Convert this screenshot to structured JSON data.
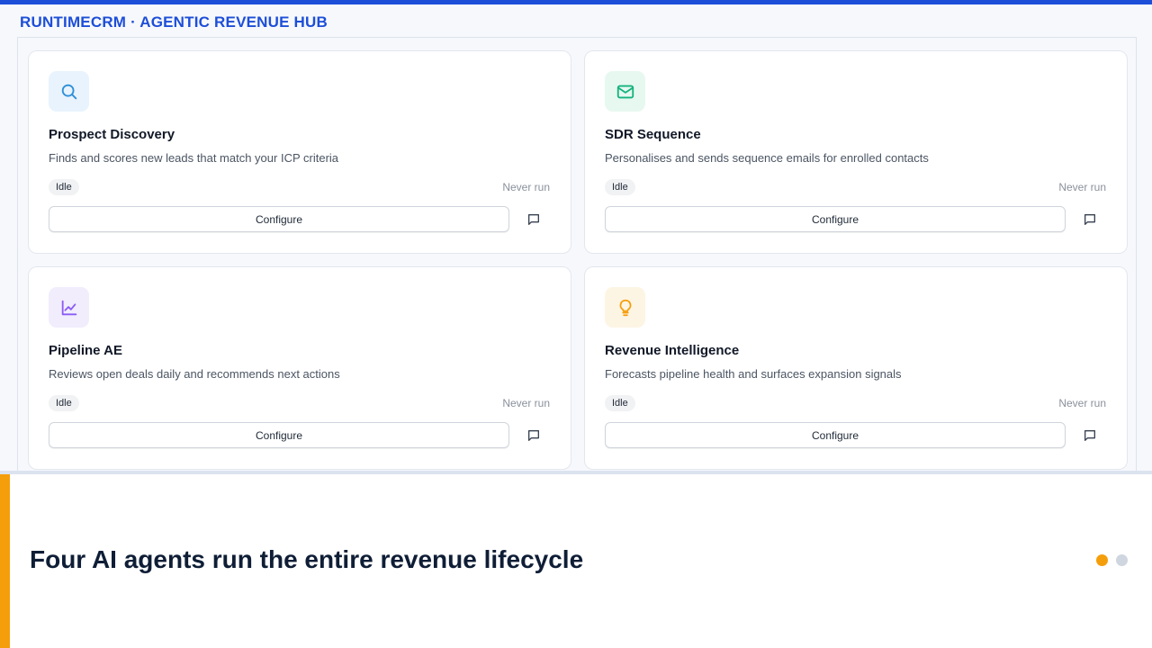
{
  "brand": {
    "title": "RUNTIMECRM · AGENTIC REVENUE HUB"
  },
  "colors": {
    "brand_blue": "#1d4ed8",
    "accent_orange": "#f59e0b",
    "headline_navy": "#0f1e36"
  },
  "agents": [
    {
      "title": "Prospect Discovery",
      "description": "Finds and scores new leads that match your ICP criteria",
      "status": "Idle",
      "last_run": "Never run",
      "configure_label": "Configure",
      "icon": "search-icon",
      "icon_color": "#2f8fd8",
      "icon_bg": "#e8f3fd"
    },
    {
      "title": "SDR Sequence",
      "description": "Personalises and sends sequence emails for enrolled contacts",
      "status": "Idle",
      "last_run": "Never run",
      "configure_label": "Configure",
      "icon": "mail-icon",
      "icon_color": "#14b37d",
      "icon_bg": "#e7f8f1"
    },
    {
      "title": "Pipeline AE",
      "description": "Reviews open deals daily and recommends next actions",
      "status": "Idle",
      "last_run": "Never run",
      "configure_label": "Configure",
      "icon": "line-chart-icon",
      "icon_color": "#8b5cf6",
      "icon_bg": "#f1edfd"
    },
    {
      "title": "Revenue Intelligence",
      "description": "Forecasts pipeline health and surfaces expansion signals",
      "status": "Idle",
      "last_run": "Never run",
      "configure_label": "Configure",
      "icon": "lightbulb-icon",
      "icon_color": "#f59e0b",
      "icon_bg": "#fdf5e4"
    }
  ],
  "slide": {
    "headline": "Four AI agents run the entire revenue lifecycle",
    "pagination": {
      "total": 2,
      "current": 1
    }
  }
}
